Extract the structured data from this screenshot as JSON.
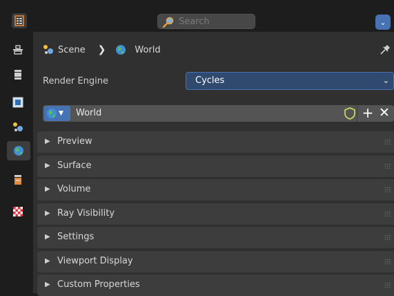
{
  "header": {
    "search_placeholder": "Search",
    "menu_arrow": "⌄"
  },
  "breadcrumb": {
    "scene": "Scene",
    "separator": "❯",
    "world": "World"
  },
  "render": {
    "label": "Render Engine",
    "engine": "Cycles",
    "arrow": "⌄"
  },
  "world_block": {
    "name": "World",
    "add": "+",
    "remove": "✕"
  },
  "panels": [
    {
      "label": "Preview"
    },
    {
      "label": "Surface"
    },
    {
      "label": "Volume"
    },
    {
      "label": "Ray Visibility"
    },
    {
      "label": "Settings"
    },
    {
      "label": "Viewport Display"
    },
    {
      "label": "Custom Properties"
    }
  ],
  "colors": {
    "accent": "#4772b3",
    "panel": "#3d3d3d",
    "background": "#303030",
    "sidebar": "#1d1d1d"
  }
}
